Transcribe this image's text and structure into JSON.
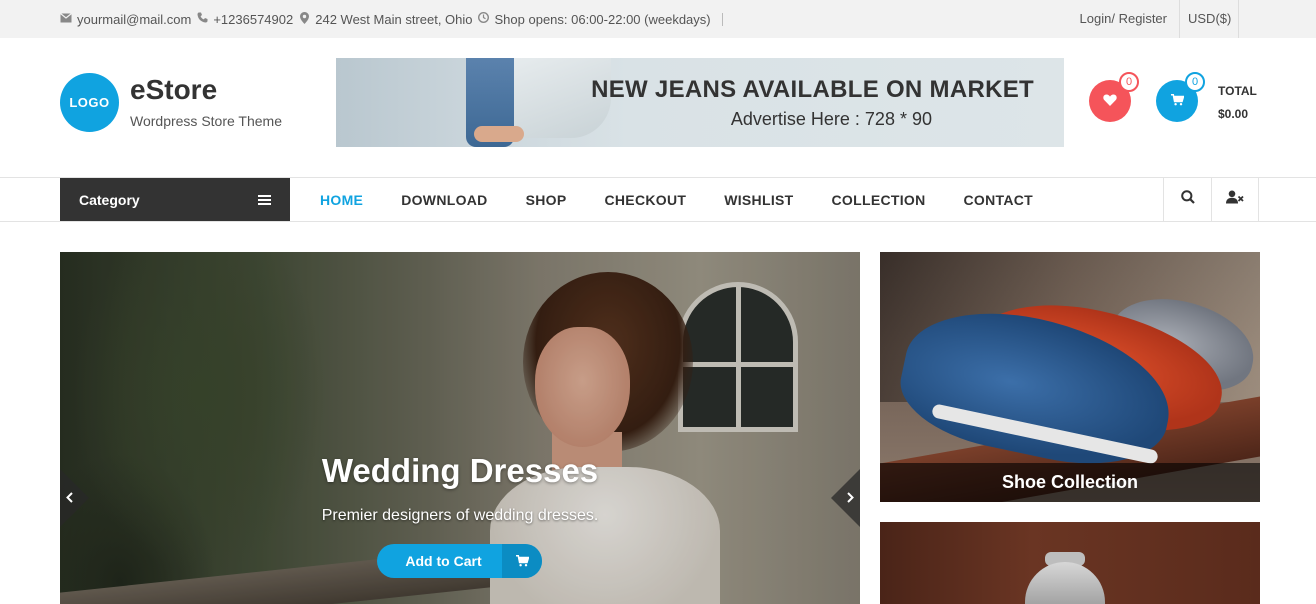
{
  "topbar": {
    "email": "yourmail@mail.com",
    "phone": "+1236574902",
    "address": "242 West Main street, Ohio",
    "hours": "Shop opens: 06:00-22:00 (weekdays)",
    "login": "Login/ Register",
    "currency": "USD($)"
  },
  "header": {
    "logo": "LOGO",
    "title": "eStore",
    "tagline": "Wordpress Store Theme",
    "banner_title": "NEW JEANS AVAILABLE ON MARKET",
    "banner_sub": "Advertise Here : 728 * 90",
    "wishlist_count": "0",
    "cart_count": "0",
    "total_label": "TOTAL",
    "total_value": "$0.00"
  },
  "nav": {
    "category": "Category",
    "items": [
      "HOME",
      "DOWNLOAD",
      "SHOP",
      "CHECKOUT",
      "WISHLIST",
      "COLLECTION",
      "CONTACT"
    ],
    "active": "HOME"
  },
  "slider": {
    "title": "Wedding Dresses",
    "subtitle": "Premier designers of wedding dresses.",
    "button": "Add to Cart"
  },
  "promos": {
    "shoe_caption": "Shoe Collection"
  },
  "colors": {
    "accent": "#10a3e0",
    "wishlist": "#f5545a",
    "dark": "#333333"
  },
  "icons": [
    "envelope-icon",
    "phone-icon",
    "map-marker-icon",
    "clock-icon",
    "heart-icon",
    "cart-icon",
    "bars-icon",
    "search-icon",
    "user-x-icon",
    "chevron-left-icon",
    "chevron-right-icon"
  ]
}
